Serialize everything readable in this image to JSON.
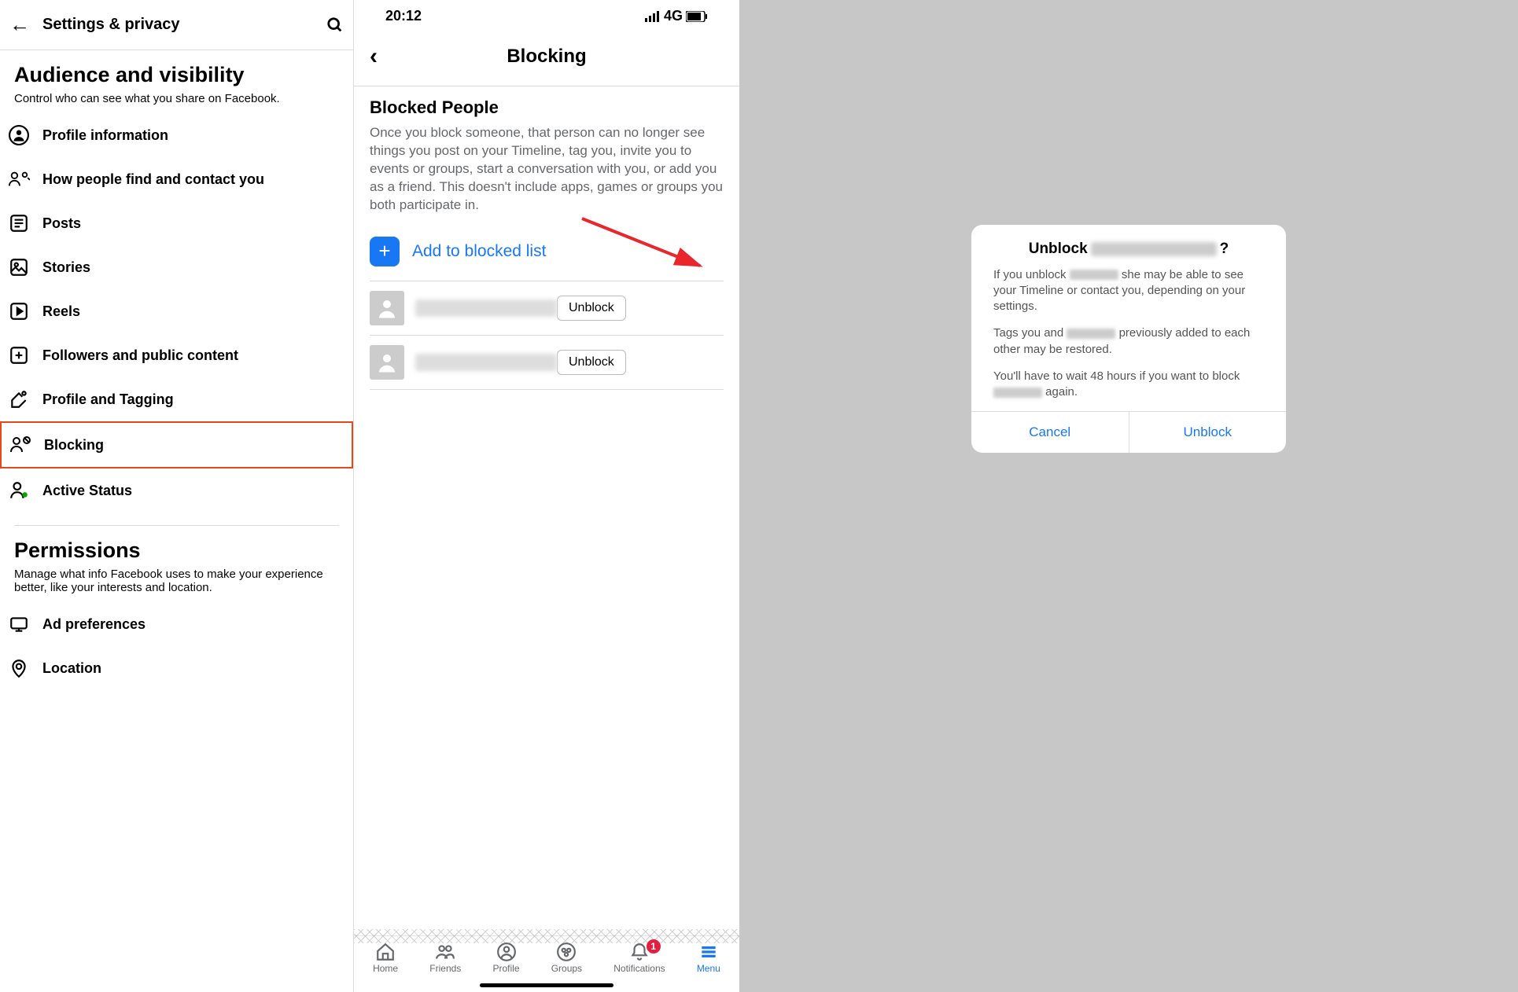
{
  "panel1": {
    "header_title": "Settings & privacy",
    "section1_title": "Audience and visibility",
    "section1_desc": "Control who can see what you share on Facebook.",
    "items": [
      "Profile information",
      "How people find and contact you",
      "Posts",
      "Stories",
      "Reels",
      "Followers and public content",
      "Profile and Tagging",
      "Blocking",
      "Active Status"
    ],
    "highlight_index": 7,
    "section2_title": "Permissions",
    "section2_desc": "Manage what info Facebook uses to make your experience better, like your interests and location.",
    "items2": [
      "Ad preferences",
      "Location"
    ]
  },
  "panel2": {
    "time": "20:12",
    "net": "4G",
    "title": "Blocking",
    "bp_title": "Blocked People",
    "bp_desc": "Once you block someone, that person can no longer see things you post on your Timeline, tag you, invite you to events or groups, start a conversation with you, or add you as a friend. This doesn't include apps, games or groups you both participate in.",
    "add_label": "Add to blocked list",
    "unblock_label": "Unblock",
    "tabs": [
      "Home",
      "Friends",
      "Profile",
      "Groups",
      "Notifications",
      "Menu"
    ],
    "badge": "1"
  },
  "panel3": {
    "title_prefix": "Unblock",
    "title_suffix": "?",
    "p1a": "If you unblock",
    "p1b": "she may be able to see your Timeline or contact you, depending on your settings.",
    "p2a": "Tags you and",
    "p2b": "previously added to each other may be restored.",
    "p3a": "You'll have to wait 48 hours if you want to block",
    "p3b": "again.",
    "cancel": "Cancel",
    "unblock": "Unblock"
  }
}
